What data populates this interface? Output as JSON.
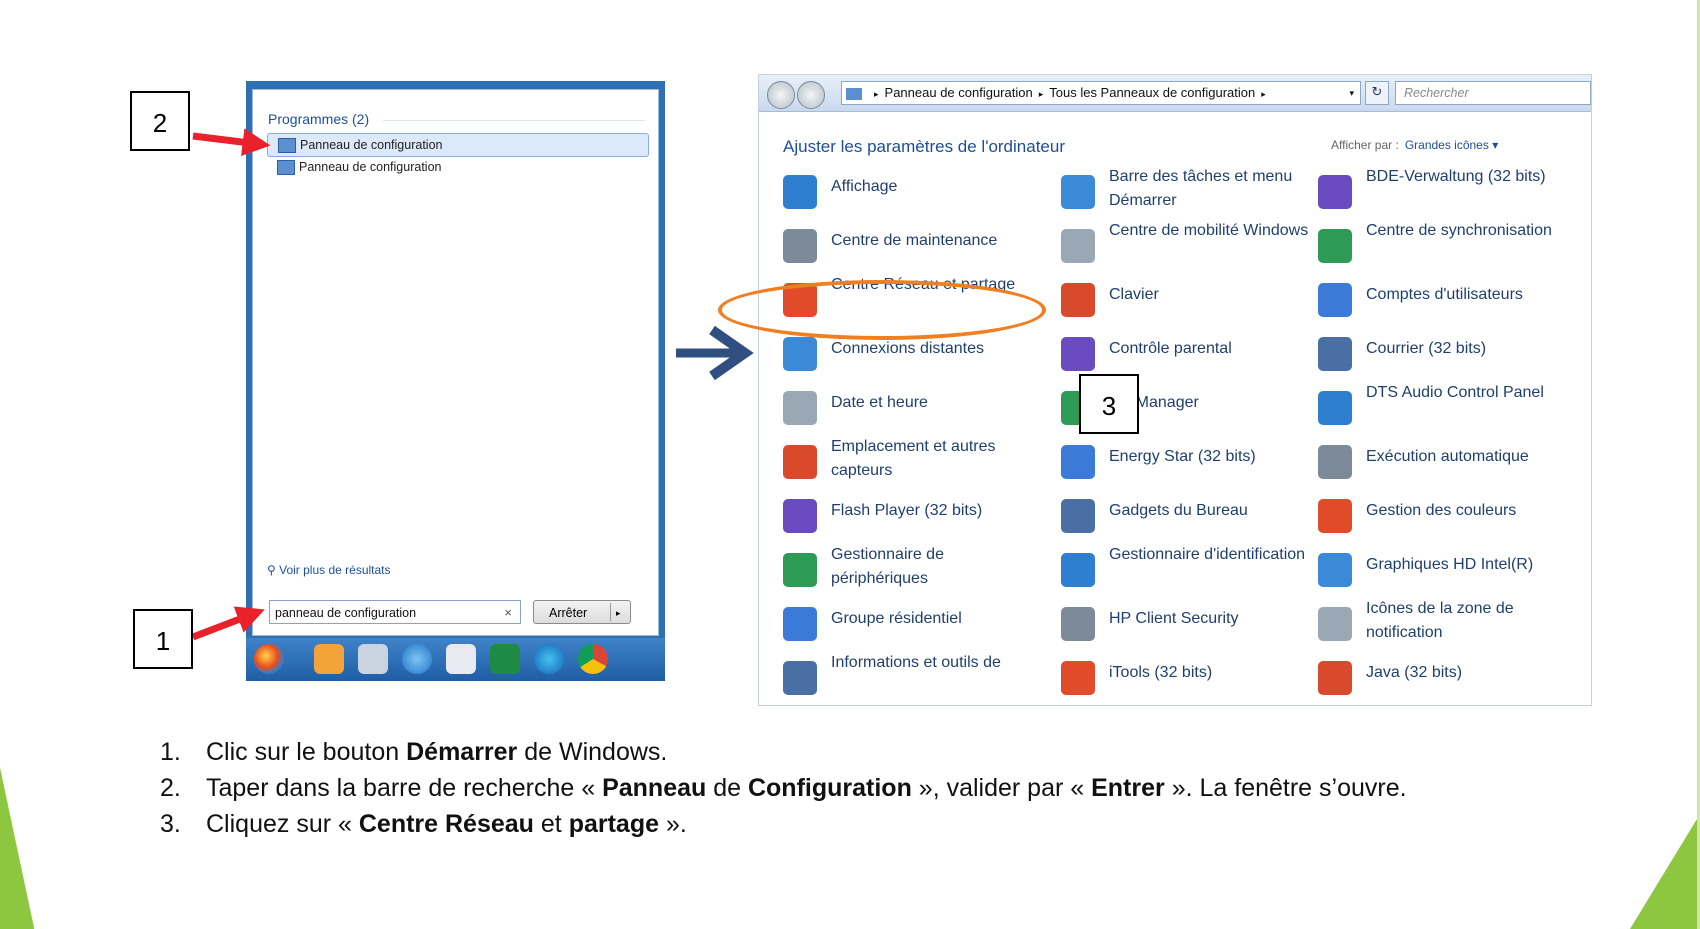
{
  "start_menu": {
    "header": "Programmes (2)",
    "items": [
      "Panneau de configuration",
      "Panneau de configuration"
    ],
    "more_results": "Voir plus de résultats",
    "search_value": "panneau de configuration",
    "clear_glyph": "×",
    "shutdown_label": "Arrêter",
    "shutdown_arrow": "▸"
  },
  "control_panel": {
    "breadcrumb": [
      "Panneau de configuration",
      "Tous les Panneaux de configuration"
    ],
    "breadcrumb_arrow": "▸",
    "dropdown_glyph": "▾",
    "refresh_glyph": "↻",
    "search_placeholder": "Rechercher",
    "title": "Ajuster les paramètres de l'ordinateur",
    "view_label": "Afficher par :",
    "view_value": "Grandes icônes ▾",
    "items": [
      [
        "Affichage",
        "Barre des tâches et menu Démarrer",
        "BDE-Verwaltung (32 bits)"
      ],
      [
        "Centre de maintenance",
        "Centre de mobilité Windows",
        "Centre de synchronisation"
      ],
      [
        "Centre Réseau et partage",
        "Clavier",
        "Comptes d'utilisateurs"
      ],
      [
        "Connexions distantes",
        "Contrôle parental",
        "Courrier (32 bits)"
      ],
      [
        "Date et heure",
        "ers Manager",
        "DTS Audio Control Panel"
      ],
      [
        "Emplacement et autres capteurs",
        "Energy Star (32 bits)",
        "Exécution automatique"
      ],
      [
        "Flash Player (32 bits)",
        "Gadgets du Bureau",
        "Gestion des couleurs"
      ],
      [
        "Gestionnaire de périphériques",
        "Gestionnaire d'identification",
        "Graphiques HD Intel(R)"
      ],
      [
        "Groupe résidentiel",
        "HP Client Security",
        "Icônes de la zone de notification"
      ],
      [
        "Informations et outils de",
        "iTools (32 bits)",
        "Java (32 bits)"
      ]
    ]
  },
  "annotations": {
    "box1": "1",
    "box2": "2",
    "box3": "3"
  },
  "steps": [
    {
      "n": "1.",
      "parts": [
        [
          "Clic sur le bouton ",
          false
        ],
        [
          "Démarrer",
          true
        ],
        [
          " de Windows.",
          false
        ]
      ]
    },
    {
      "n": "2.",
      "parts": [
        [
          "Taper dans la barre de recherche « ",
          false
        ],
        [
          "Panneau",
          true
        ],
        [
          " de ",
          false
        ],
        [
          "Configuration",
          true
        ],
        [
          " », valider par « ",
          false
        ],
        [
          "Entrer",
          true
        ],
        [
          " ». La fenêtre s’ouvre.",
          false
        ]
      ]
    },
    {
      "n": "3.",
      "parts": [
        [
          "Cliquez sur « ",
          false
        ],
        [
          "Centre Réseau",
          true
        ],
        [
          " et ",
          false
        ],
        [
          "partage",
          true
        ],
        [
          " ».",
          false
        ]
      ]
    }
  ],
  "colors": {
    "accent_green": "#8dc63f",
    "arrow_red": "#e8212a",
    "ellipse_orange": "#f07f22",
    "arrow_blue": "#2f4f80",
    "link_blue": "#1e4e9b"
  }
}
